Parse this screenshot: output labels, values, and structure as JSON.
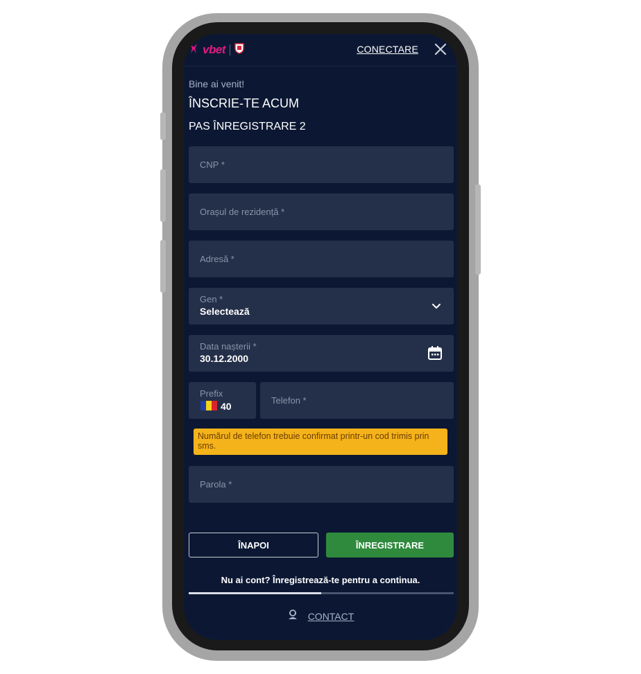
{
  "header": {
    "logo_text": "vbet",
    "login_label": "CONECTARE"
  },
  "intro": {
    "welcome": "Bine ai venit!",
    "title": "ÎNSCRIE-TE ACUM",
    "step": "PAS ÎNREGISTRARE 2"
  },
  "form": {
    "cnp_label": "CNP *",
    "city_label": "Orașul de rezidență *",
    "address_label": "Adresă *",
    "gender_label": "Gen *",
    "gender_value": "Selectează",
    "birthdate_label": "Data nașterii *",
    "birthdate_value": "30.12.2000",
    "prefix_label": "Prefix",
    "prefix_value": "40",
    "phone_label": "Telefon *",
    "phone_notice": "Numărul de telefon trebuie confirmat printr-un cod trimis prin sms.",
    "password_label": "Parola *"
  },
  "actions": {
    "back_label": "ÎNAPOI",
    "register_label": "ÎNREGISTRARE"
  },
  "footer": {
    "prompt": "Nu ai cont? Înregistrează-te pentru a continua.",
    "progress_fraction": 0.5,
    "contact_label": "CONTACT"
  },
  "colors": {
    "brand": "#e11a83",
    "background": "#0c1833",
    "field": "#243049",
    "register_button": "#2f8a3d",
    "notice": "#f5b31b"
  },
  "icons": [
    "vbet-logo-icon",
    "crest-icon",
    "close-icon",
    "chevron-down-icon",
    "calendar-icon",
    "romania-flag-icon",
    "support-agent-icon"
  ]
}
